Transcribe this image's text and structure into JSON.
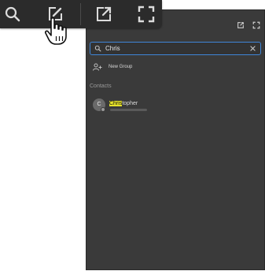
{
  "toolbar": {
    "buttons": [
      {
        "icon": "search-icon"
      },
      {
        "icon": "compose-icon"
      },
      {
        "icon": "popout-icon"
      },
      {
        "icon": "fullscreen-icon"
      }
    ]
  },
  "panel": {
    "top_icons": [
      "popout-icon",
      "fullscreen-icon"
    ],
    "search": {
      "value": "Chris"
    },
    "new_group_label": "New Group",
    "contacts_section_label": "Contacts",
    "contacts": [
      {
        "initial": "C",
        "name_match": "Chris",
        "name_rest": "topher"
      }
    ]
  },
  "colors": {
    "panel_bg": "#3a3a3a",
    "search_focus_border": "#3f86d8",
    "highlight": "#e6e22a"
  }
}
